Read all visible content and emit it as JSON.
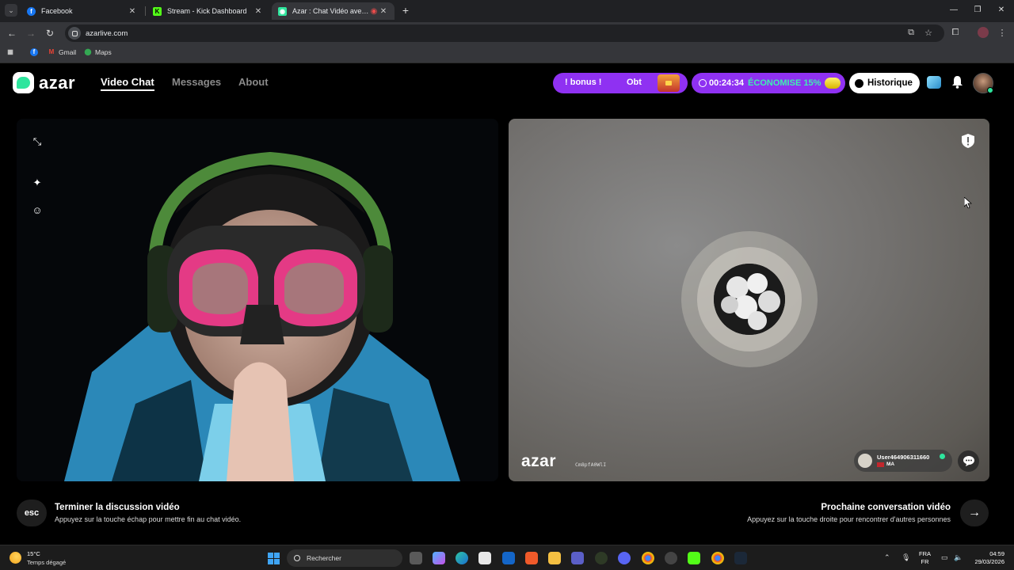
{
  "browser": {
    "tabs": [
      {
        "title": "Facebook",
        "favicon": "facebook-icon",
        "color": "#1877f2"
      },
      {
        "title": "Stream - Kick Dashboard",
        "favicon": "kick-icon",
        "color": "#53fc18"
      },
      {
        "title": "Azar : Chat Vidéo avec de n",
        "favicon": "azar-icon",
        "color": "#2ee59d",
        "active": true
      }
    ],
    "url": "azarlive.com",
    "bookmarks": [
      "Gmail",
      "Maps"
    ]
  },
  "header": {
    "logo_text": "azar",
    "nav": [
      "Video Chat",
      "Messages",
      "About"
    ],
    "promo_left": "! bonus !",
    "promo_right": "Obt",
    "timer": "00:24:34",
    "save_text": "ÉCONOMISE 15%",
    "history_label": "Historique"
  },
  "remote": {
    "watermark": "azar",
    "session_id": "Cm8pfA0WlI",
    "username": "User464906311660",
    "country": "MA"
  },
  "controls": {
    "esc_key": "esc",
    "end_title": "Terminer la discussion vidéo",
    "end_sub": "Appuyez sur la touche échap pour mettre fin au chat vidéo.",
    "next_title": "Prochaine conversation vidéo",
    "next_sub": "Appuyez sur la touche droite pour rencontrer d'autres personnes"
  },
  "taskbar": {
    "temperature": "15°C",
    "weather": "Temps dégagé",
    "search_placeholder": "Rechercher",
    "lang_top": "FRA",
    "lang_bottom": "FR",
    "time": "04:59",
    "date": "29/03/2026"
  },
  "colors": {
    "accent": "#8f31f2",
    "brand": "#2ee59d"
  }
}
